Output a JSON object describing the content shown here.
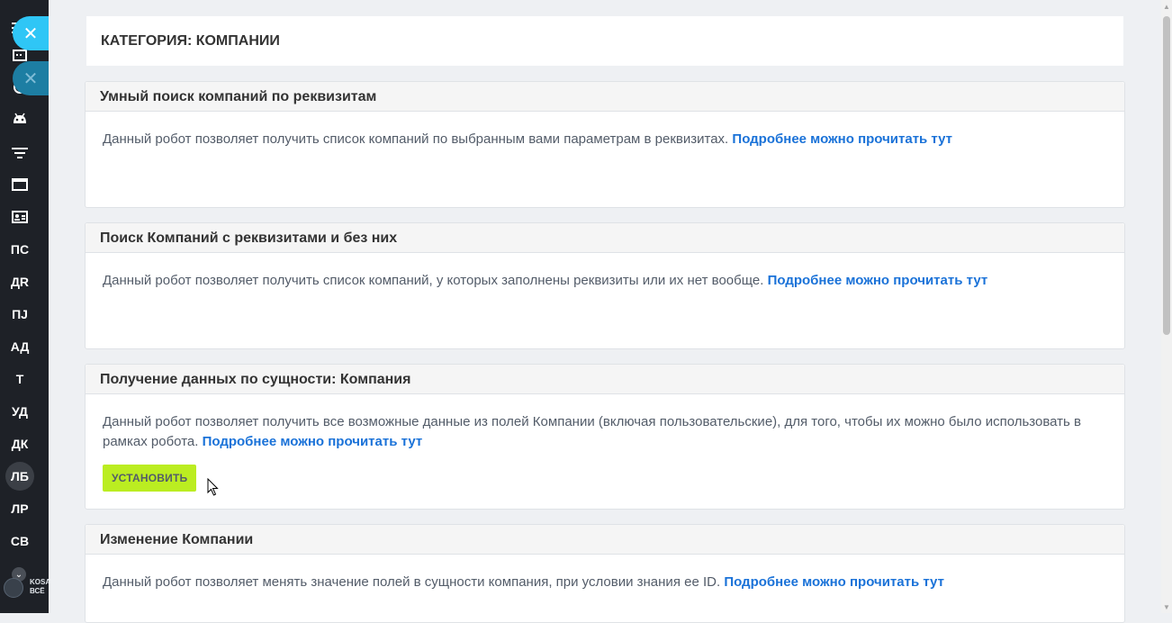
{
  "sidebar": {
    "labels": [
      {
        "text": "ПС"
      },
      {
        "text": "ДR"
      },
      {
        "text": "ПJ"
      },
      {
        "text": "АД"
      },
      {
        "text": "Т"
      },
      {
        "text": "УД"
      },
      {
        "text": "ДК"
      },
      {
        "text": "ЛБ"
      },
      {
        "text": "ЛР"
      },
      {
        "text": "СВ"
      }
    ],
    "user_line1": "KOSA",
    "user_line2": "ВСЁ"
  },
  "header": {
    "title": "КАТЕГОРИЯ: КОМПАНИИ"
  },
  "cards": [
    {
      "title": "Умный поиск компаний по реквизитам",
      "description": "Данный робот позволяет получить список компаний по выбранным вами параметрам в реквизитах.",
      "link": "Подробнее можно прочитать тут"
    },
    {
      "title": "Поиск Компаний с реквизитами и без них",
      "description": "Данный робот позволяет получить список компаний, у которых заполнены реквизиты или их нет вообще.",
      "link": "Подробнее можно прочитать тут"
    },
    {
      "title": "Получение данных по сущности: Компания",
      "description": "Данный робот позволяет получить все возможные данные из полей Компании (включая пользовательские), для того, чтобы их можно было использовать в рамках робота.",
      "link": "Подробнее можно прочитать тут",
      "button": "УСТАНОВИТЬ"
    },
    {
      "title": "Изменение Компании",
      "description": "Данный робот позволяет менять значение полей в сущности компания, при условии знания ее ID.",
      "link": "Подробнее можно прочитать тут"
    }
  ],
  "colors": {
    "accent_link": "#1a72d8",
    "install_button": "#bbed21",
    "close_button": "#2fc6f6",
    "sidebar_bg": "#1e2127"
  }
}
